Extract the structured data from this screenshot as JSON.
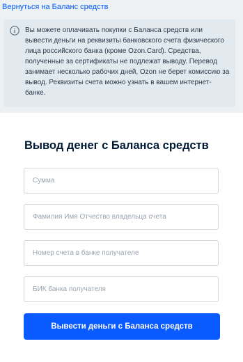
{
  "back_link": {
    "label": "Вернуться на Баланс средств"
  },
  "info": {
    "icon": "info-icon",
    "text": "Вы можете оплачивать покупки с Баланса средств или вывести деньги на реквизиты банковского счета физического лица российского банка (кроме Ozon.Card). Средства, полученные за сертификаты не подлежат выводу. Перевод занимает несколько рабочих дней, Ozon не берет комиссию за вывод. Реквизиты счета можно узнать в вашем интернет-банке."
  },
  "form": {
    "title": "Вывод денег с Баланса средств",
    "fields": {
      "amount_placeholder": "Сумма",
      "owner_name_placeholder": "Фамилия Имя Отчество владельца счета",
      "account_number_placeholder": "Номер счета в банке получателе",
      "bik_placeholder": "БИК банка получателя"
    },
    "submit_label": "Вывести деньги с Баланса средств"
  },
  "colors": {
    "accent": "#005bff",
    "button": "#0a5bff",
    "info_background": "#e2e9ef",
    "page_background": "#eef1f4"
  }
}
